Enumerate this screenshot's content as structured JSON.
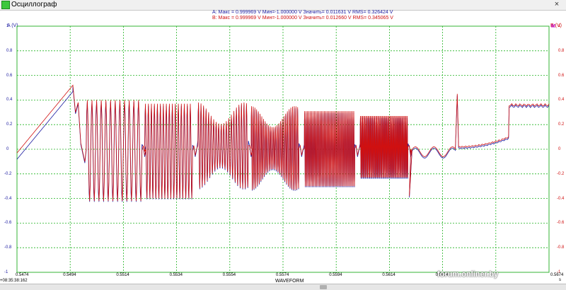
{
  "window": {
    "title": "Осциллограф",
    "close_glyph": "×"
  },
  "stats": {
    "a": "A:  Макс = 0.999969 V  Мин=-1.000000 V  Значить= 0.011631 V  RMS= 0.326424 V",
    "b": "B:  Макс = 0.999969 V  Мин=-1.000000 V  Значить= 0.012660 V  RMS= 0.345065 V"
  },
  "axes": {
    "a_label": "A (V)",
    "b_label": "B (V)",
    "m_badge": "M",
    "y_left": [
      "1",
      "0.8",
      "0.6",
      "0.4",
      "0.2",
      "0",
      "-0.2",
      "-0.4",
      "-0.6",
      "-0.8",
      "-1"
    ],
    "y_right": [
      "1",
      "0.8",
      "0.6",
      "0.4",
      "0.2",
      "0",
      "-0.2",
      "-0.4",
      "-0.6",
      "-0.8",
      "-1"
    ],
    "x_ticks": [
      "0.5474",
      "0.5494",
      "0.5514",
      "0.5534",
      "0.5554",
      "0.5574",
      "0.5594",
      "0.5614",
      "0.5634",
      "0.5674"
    ],
    "x_label": "WAVEFORM",
    "x_unit": "s",
    "timestamp": "+08:35:38:162"
  },
  "watermark": "forum.onliner.by",
  "colors": {
    "channel_a": "#1a1aa0",
    "channel_b": "#d01010",
    "grid": "#22b422",
    "frame": "#34b434"
  },
  "chart_data": {
    "type": "line",
    "xlabel": "WAVEFORM",
    "ylabel": "A (V)",
    "ylim": [
      -1,
      1
    ],
    "xlim": [
      0.5474,
      0.5674
    ],
    "grid": true,
    "series": [
      {
        "name": "A"
      },
      {
        "name": "B"
      }
    ],
    "segments": [
      {
        "x": [
          0.5474,
          0.5495
        ],
        "shape": "ramp",
        "y": [
          -0.05,
          0.5
        ]
      },
      {
        "x": [
          0.55,
          0.5521
        ],
        "shape": "sine",
        "amplitude": [
          -0.42,
          0.4
        ]
      },
      {
        "x": [
          0.5522,
          0.554
        ],
        "shape": "sine",
        "amplitude": [
          -0.4,
          0.37
        ]
      },
      {
        "x": [
          0.5542,
          0.5561
        ],
        "shape": "sine",
        "amplitude": [
          -0.32,
          0.38
        ]
      },
      {
        "x": [
          0.5562,
          0.558
        ],
        "shape": "sine",
        "amplitude": [
          -0.33,
          0.35
        ]
      },
      {
        "x": [
          0.5582,
          0.5601
        ],
        "shape": "sine",
        "amplitude": [
          -0.3,
          0.31
        ]
      },
      {
        "x": [
          0.5603,
          0.5621
        ],
        "shape": "sine",
        "amplitude": [
          -0.23,
          0.27
        ]
      },
      {
        "x": [
          0.5622,
          0.5639
        ],
        "shape": "flat",
        "y": 0.0
      },
      {
        "x": [
          0.564,
          0.5659
        ],
        "shape": "ramp",
        "y": [
          0.0,
          0.35
        ]
      },
      {
        "x": [
          0.5659,
          0.5674
        ],
        "shape": "flat",
        "y": 0.35
      }
    ]
  }
}
